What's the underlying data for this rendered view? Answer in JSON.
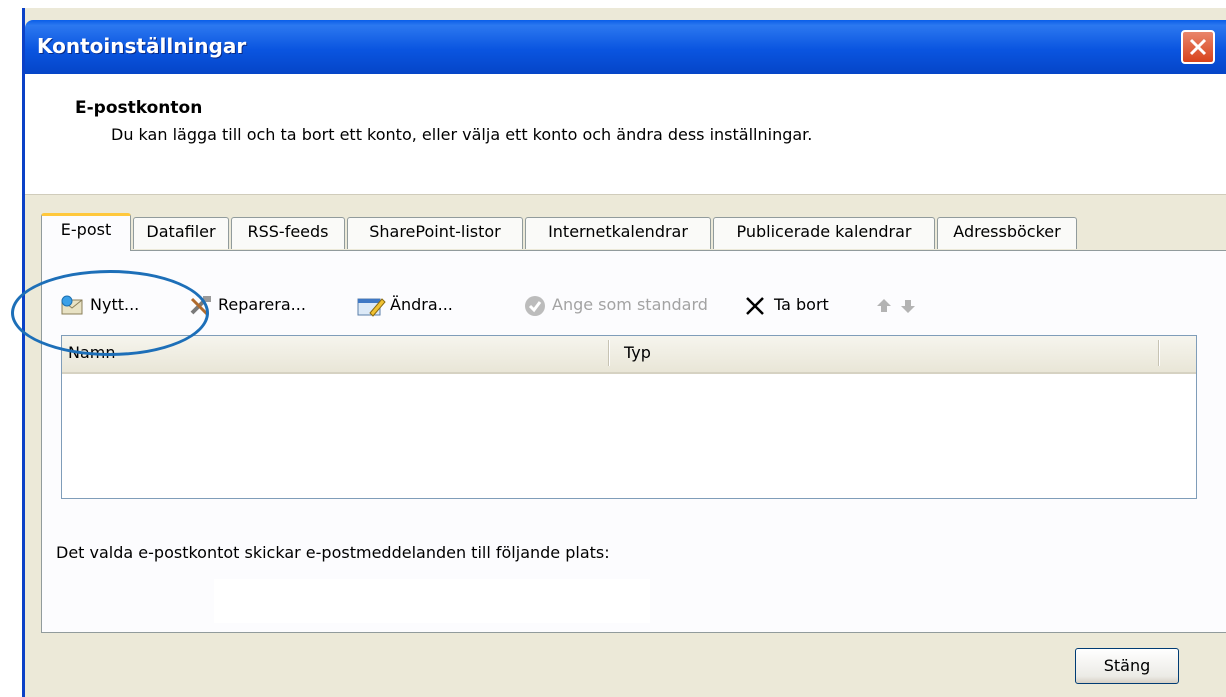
{
  "window": {
    "title": "Kontoinställningar"
  },
  "header": {
    "title": "E-postkonton",
    "description": "Du kan lägga till och ta bort ett konto, eller välja ett konto och ändra dess inställningar."
  },
  "tabs": [
    {
      "label": "E-post",
      "active": true
    },
    {
      "label": "Datafiler"
    },
    {
      "label": "RSS-feeds"
    },
    {
      "label": "SharePoint-listor"
    },
    {
      "label": "Internetkalendrar"
    },
    {
      "label": "Publicerade kalendrar"
    },
    {
      "label": "Adressböcker"
    }
  ],
  "toolbar": {
    "new_label": "Nytt...",
    "repair_label": "Reparera...",
    "change_label": "Ändra...",
    "set_default_label": "Ange som standard",
    "remove_label": "Ta bort",
    "icons": [
      "envelope-icon",
      "tools-icon",
      "edit-icon",
      "checkmark-icon",
      "delete-x-icon",
      "arrow-up-icon",
      "arrow-down-icon"
    ]
  },
  "account_list": {
    "columns": [
      "Namn",
      "Typ"
    ],
    "rows": []
  },
  "delivery": {
    "text": "Det valda e-postkontot skickar e-postmeddelanden till följande plats:",
    "location": ""
  },
  "footer": {
    "close_label": "Stäng"
  },
  "colors": {
    "titlebar": "#0a55e0",
    "dialog_bg": "#ece9d8",
    "active_tab_accent": "#ffc83c",
    "annotation": "#1d6fb8"
  }
}
